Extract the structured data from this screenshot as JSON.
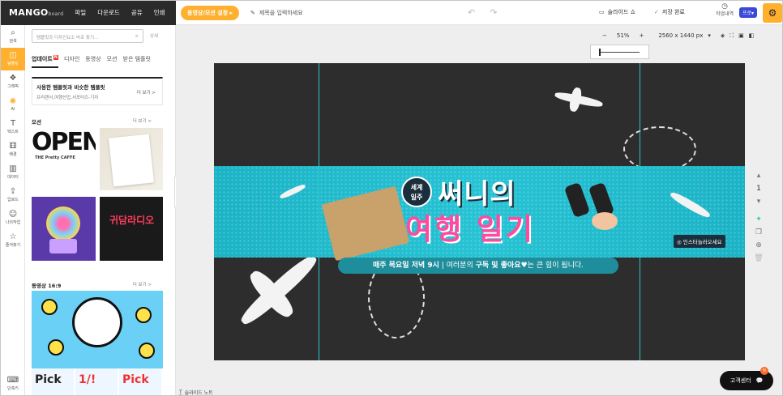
{
  "topbar": {
    "logo": "MANGO",
    "logo_sub": "board",
    "menus": [
      "파일",
      "다운로드",
      "공유",
      "인쇄"
    ],
    "mode_label": "동영상/모션 설정",
    "title_placeholder": "제목을 입력하세요",
    "slideshow_label": "슬라이드 쇼",
    "save_label": "저장 완료",
    "history_label": "작업내역",
    "pro_label": "프로"
  },
  "rail": {
    "items": [
      "검색",
      "템플릿",
      "그래픽",
      "AI",
      "텍스트",
      "배경",
      "데이터",
      "업로드",
      "나의작업",
      "즐겨찾기"
    ],
    "active_index": 1,
    "bottom_label": "단축키"
  },
  "panel": {
    "search_placeholder": "템플릿과 디자인요소 바로 찾기...",
    "search_detail": "상세",
    "tabs": [
      "업데이트",
      "디자인",
      "동영상",
      "모션",
      "받은 템플릿"
    ],
    "new_badge": "N",
    "banner_title": "사용한 템플릿과 비슷한 템플릿",
    "banner_sub": "프리랜서,여행산업,서포터즈-기자",
    "banner_more": "더 보기 >",
    "section_motion": "모션",
    "section_motion_more": "더 보기 >",
    "open_text": "OPEN",
    "open_sub": "THE Pretty CAFFE",
    "radio_text": "귀담라디오",
    "section_video": "동영상 16:9",
    "section_video_more": "더 보기 >",
    "pick_labels": [
      "Pick",
      "1/!",
      "Pick"
    ]
  },
  "workspace": {
    "zoom_minus": "−",
    "zoom_value": "51%",
    "zoom_plus": "+",
    "canvas_size": "2560 x 1440 px",
    "slide_number": "1",
    "slide_note": "슬라이드 노트",
    "help_label": "고객센터",
    "help_badge": "N"
  },
  "design": {
    "badge": "세계\n일주",
    "title_line1": "써니의",
    "title_line2": "여행 일기",
    "insta": "인스타놀러오세요",
    "subline_bold1": "매주 목요일 저녁 9시",
    "subline_mid": " | 여러분의 ",
    "subline_bold2": "구독 및 좋아요",
    "subline_end": "♥는 큰 힘이 됩니다."
  },
  "colors": {
    "accent": "#ffb02e",
    "teal": "#1ab3c6",
    "pink": "#ff4aa0",
    "canvas_bg": "#2d2d2d",
    "pro": "#3a49d9"
  }
}
